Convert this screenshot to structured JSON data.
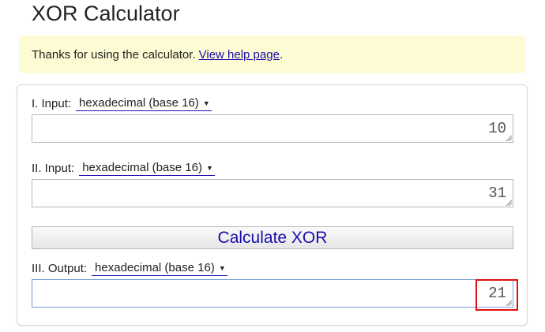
{
  "page": {
    "title": "XOR Calculator"
  },
  "notice": {
    "text": "Thanks for using the calculator.",
    "link_label": "View help page",
    "trailing": "."
  },
  "inputs": [
    {
      "label": "I. Input:",
      "base": "hexadecimal (base 16)",
      "value": "10"
    },
    {
      "label": "II. Input:",
      "base": "hexadecimal (base 16)",
      "value": "31"
    }
  ],
  "calculate_button": {
    "label": "Calculate XOR"
  },
  "output": {
    "label": "III. Output:",
    "base": "hexadecimal (base 16)",
    "value": "21"
  },
  "icons": {
    "dropdown": "caret-down-icon",
    "resize": "resize-grip-icon"
  },
  "colors": {
    "notice_bg": "#fdfbd3",
    "link": "#1a0dab",
    "highlight": "#e01010"
  }
}
